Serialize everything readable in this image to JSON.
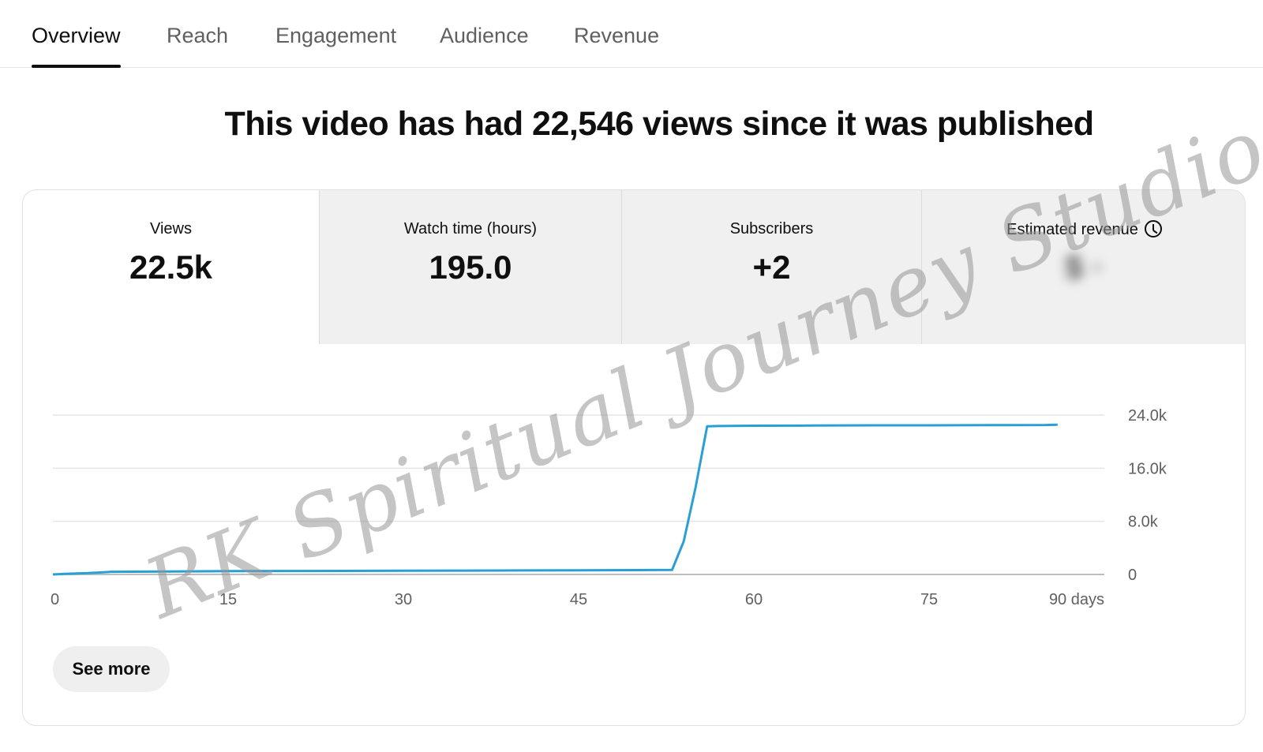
{
  "tabs": [
    {
      "label": "Overview",
      "active": true
    },
    {
      "label": "Reach",
      "active": false
    },
    {
      "label": "Engagement",
      "active": false
    },
    {
      "label": "Audience",
      "active": false
    },
    {
      "label": "Revenue",
      "active": false
    }
  ],
  "headline": "This video has had 22,546 views since it was published",
  "metrics": [
    {
      "label": "Views",
      "value": "22.5k"
    },
    {
      "label": "Watch time (hours)",
      "value": "195.0"
    },
    {
      "label": "Subscribers",
      "value": "+2"
    },
    {
      "label": "Estimated revenue",
      "value": "$ ·",
      "icon": "clock-icon"
    }
  ],
  "see_more_label": "See more",
  "watermark": "RK Spiritual Journey Studio",
  "colors": {
    "line": "#2a9fd6",
    "grid": "#e5e5e5",
    "inactive_metric_bg": "#f0f0f0"
  },
  "chart_data": {
    "type": "line",
    "x_ticks": [
      0,
      15,
      30,
      45,
      60,
      75,
      90
    ],
    "x_tick_labels": [
      "0",
      "15",
      "30",
      "45",
      "60",
      "75",
      "90 days"
    ],
    "y_ticks": [
      0,
      8000,
      16000,
      24000
    ],
    "y_tick_labels": [
      "0",
      "8.0k",
      "16.0k",
      "24.0k"
    ],
    "xlim": [
      0,
      90
    ],
    "ylim": [
      0,
      24000
    ],
    "grid": true,
    "series": [
      {
        "x": [
          0,
          1,
          2,
          3,
          4,
          5,
          10,
          15,
          20,
          25,
          30,
          35,
          40,
          45,
          50,
          53,
          54,
          55,
          56,
          57,
          60,
          65,
          70,
          75,
          80,
          85,
          86
        ],
        "y": [
          0,
          100,
          150,
          200,
          300,
          400,
          450,
          500,
          520,
          540,
          560,
          580,
          600,
          620,
          650,
          680,
          5000,
          13000,
          22300,
          22350,
          22400,
          22420,
          22450,
          22460,
          22480,
          22500,
          22546
        ]
      }
    ]
  }
}
